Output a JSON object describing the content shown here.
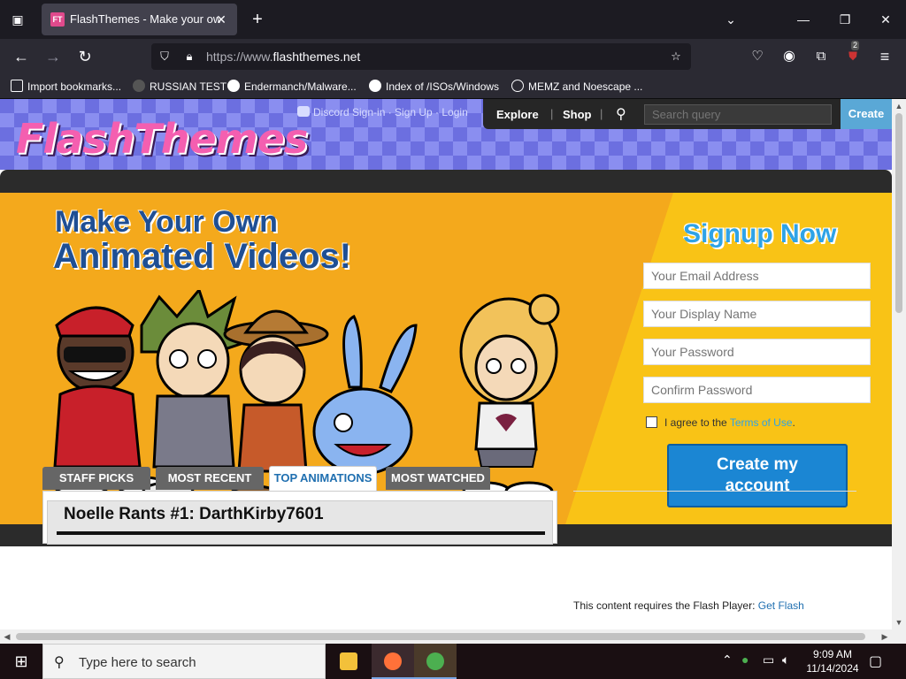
{
  "browser": {
    "tab_title": "FlashThemes - Make your own",
    "url_scheme": "https://www.",
    "url_host": "flashthemes.net",
    "bookmarks": [
      {
        "label": "Import bookmarks..."
      },
      {
        "label": "RUSSIAN TEST"
      },
      {
        "label": "Endermanch/Malware..."
      },
      {
        "label": "Index of /ISOs/Windows"
      },
      {
        "label": "MEMZ and Noescape ..."
      }
    ],
    "extension_badge": "2"
  },
  "site": {
    "logo": "FlashThemes",
    "signin_links": "Discord Sign-in · Sign Up · Login",
    "nav": {
      "explore": "Explore",
      "shop": "Shop",
      "create": "Create"
    },
    "search_placeholder": "Search query"
  },
  "hero": {
    "title_line1": "Make Your Own",
    "title_line2": "Animated Videos!"
  },
  "signup": {
    "title": "Signup Now",
    "email_placeholder": "Your Email Address",
    "display_name_placeholder": "Your Display Name",
    "password_placeholder": "Your Password",
    "confirm_password_placeholder": "Confirm Password",
    "agree_prefix": "I agree to the ",
    "terms_link": "Terms of Use",
    "agree_suffix": ".",
    "create_line1": "Create my",
    "create_line2": "account"
  },
  "content": {
    "tabs": [
      {
        "label": "STAFF PICKS",
        "active": false
      },
      {
        "label": "MOST RECENT",
        "active": false
      },
      {
        "label": "TOP ANIMATIONS",
        "active": true
      },
      {
        "label": "MOST WATCHED",
        "active": false
      }
    ],
    "featured_title": "Noelle Rants #1: DarthKirby7601",
    "flash_note_prefix": "This content requires the Flash Player: ",
    "flash_link": "Get Flash"
  },
  "taskbar": {
    "search_placeholder": "Type here to search",
    "time": "9:09 AM",
    "date": "11/14/2024"
  },
  "colors": {
    "hero_yellow": "#f9c316",
    "hero_orange": "#f4a91c",
    "title_blue": "#1f4f94",
    "signup_blue": "#2fa3e6",
    "button_blue": "#1b86d3"
  }
}
